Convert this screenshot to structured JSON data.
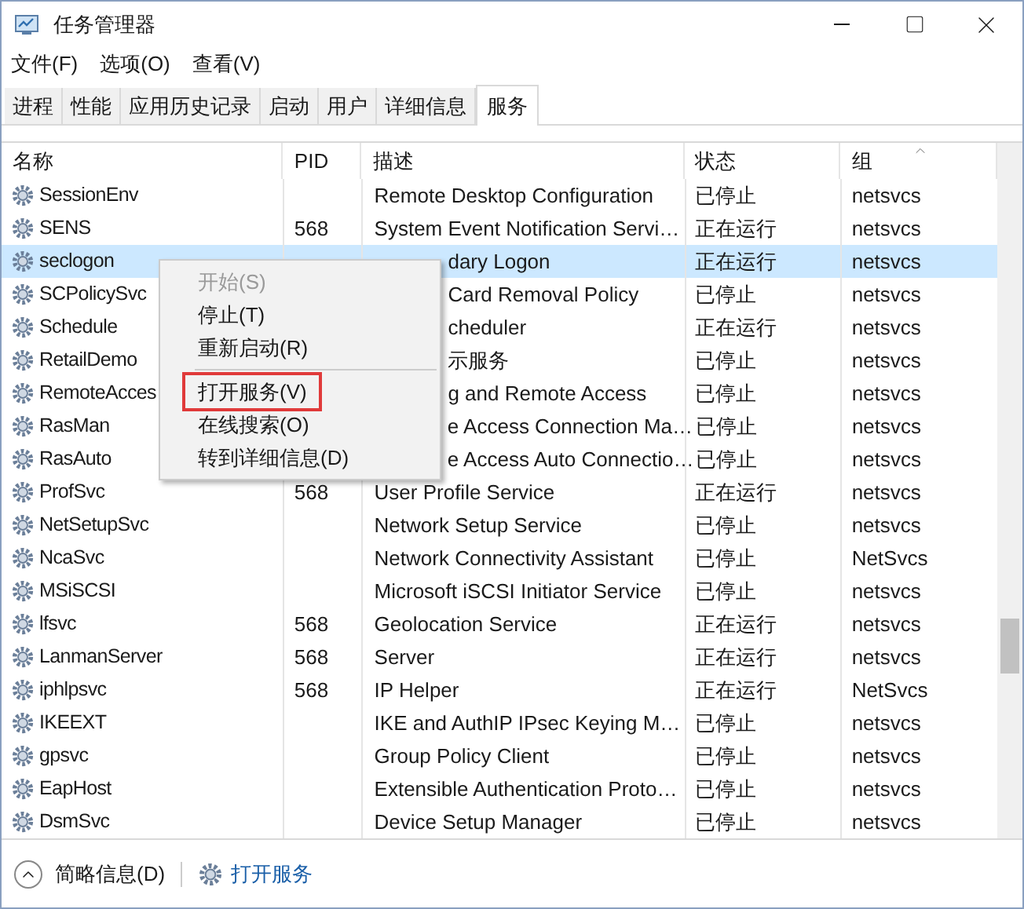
{
  "window": {
    "title": "任务管理器"
  },
  "menu_bar": [
    "文件(F)",
    "选项(O)",
    "查看(V)"
  ],
  "tabs": [
    {
      "label": "进程",
      "selected": false
    },
    {
      "label": "性能",
      "selected": false
    },
    {
      "label": "应用历史记录",
      "selected": false
    },
    {
      "label": "启动",
      "selected": false
    },
    {
      "label": "用户",
      "selected": false
    },
    {
      "label": "详细信息",
      "selected": false
    },
    {
      "label": "服务",
      "selected": true
    }
  ],
  "columns": [
    {
      "label": "名称",
      "sorted": false
    },
    {
      "label": "PID",
      "sorted": false
    },
    {
      "label": "描述",
      "sorted": false
    },
    {
      "label": "状态",
      "sorted": false
    },
    {
      "label": "组",
      "sorted": true
    }
  ],
  "rows": [
    {
      "name": "SessionEnv",
      "description": "Remote Desktop Configuration",
      "status": "已停止",
      "group": "netsvcs",
      "selected": false,
      "covered": false
    },
    {
      "name": "SENS",
      "pid": "568",
      "description": "System Event Notification Servi…",
      "status": "正在运行",
      "group": "netsvcs",
      "selected": false,
      "covered": false
    },
    {
      "name": "seclogon",
      "description": "dary Logon",
      "status": "正在运行",
      "group": "netsvcs",
      "selected": true,
      "covered": true
    },
    {
      "name": "SCPolicySvc",
      "description": "Card Removal Policy",
      "status": "已停止",
      "group": "netsvcs",
      "selected": false,
      "covered": true
    },
    {
      "name": "Schedule",
      "description": "cheduler",
      "status": "正在运行",
      "group": "netsvcs",
      "selected": false,
      "covered": true
    },
    {
      "name": "RetailDemo",
      "description": "示服务",
      "status": "已停止",
      "group": "netsvcs",
      "selected": false,
      "covered": true
    },
    {
      "name": "RemoteAcces",
      "description": "g and Remote Access",
      "status": "已停止",
      "group": "netsvcs",
      "selected": false,
      "covered": true
    },
    {
      "name": "RasMan",
      "description": "e Access Connection Ma…",
      "status": "已停止",
      "group": "netsvcs",
      "selected": false,
      "covered": true
    },
    {
      "name": "RasAuto",
      "description": "e Access Auto Connectio…",
      "status": "已停止",
      "group": "netsvcs",
      "selected": false,
      "covered": true
    },
    {
      "name": "ProfSvc",
      "pid": "568",
      "description": "User Profile Service",
      "status": "正在运行",
      "group": "netsvcs",
      "selected": false,
      "covered": false
    },
    {
      "name": "NetSetupSvc",
      "description": "Network Setup Service",
      "status": "已停止",
      "group": "netsvcs",
      "selected": false,
      "covered": false
    },
    {
      "name": "NcaSvc",
      "description": "Network Connectivity Assistant",
      "status": "已停止",
      "group": "NetSvcs",
      "selected": false,
      "covered": false
    },
    {
      "name": "MSiSCSI",
      "description": "Microsoft iSCSI Initiator Service",
      "status": "已停止",
      "group": "netsvcs",
      "selected": false,
      "covered": false
    },
    {
      "name": "lfsvc",
      "pid": "568",
      "description": "Geolocation Service",
      "status": "正在运行",
      "group": "netsvcs",
      "selected": false,
      "covered": false
    },
    {
      "name": "LanmanServer",
      "pid": "568",
      "description": "Server",
      "status": "正在运行",
      "group": "netsvcs",
      "selected": false,
      "covered": false
    },
    {
      "name": "iphlpsvc",
      "pid": "568",
      "description": "IP Helper",
      "status": "正在运行",
      "group": "NetSvcs",
      "selected": false,
      "covered": false
    },
    {
      "name": "IKEEXT",
      "description": "IKE and AuthIP IPsec Keying M…",
      "status": "已停止",
      "group": "netsvcs",
      "selected": false,
      "covered": false
    },
    {
      "name": "gpsvc",
      "description": "Group Policy Client",
      "status": "已停止",
      "group": "netsvcs",
      "selected": false,
      "covered": false
    },
    {
      "name": "EapHost",
      "description": "Extensible Authentication Proto…",
      "status": "已停止",
      "group": "netsvcs",
      "selected": false,
      "covered": false
    },
    {
      "name": "DsmSvc",
      "description": "Device Setup Manager",
      "status": "已停止",
      "group": "netsvcs",
      "selected": false,
      "covered": false
    }
  ],
  "context_menu": [
    {
      "label": "开始(S)",
      "disabled": true,
      "highlighted": false,
      "separator_after": false
    },
    {
      "label": "停止(T)",
      "disabled": false,
      "highlighted": false,
      "separator_after": false
    },
    {
      "label": "重新启动(R)",
      "disabled": false,
      "highlighted": false,
      "separator_after": true
    },
    {
      "label": "打开服务(V)",
      "disabled": false,
      "highlighted": true,
      "separator_after": false
    },
    {
      "label": "在线搜索(O)",
      "disabled": false,
      "highlighted": false,
      "separator_after": false
    },
    {
      "label": "转到详细信息(D)",
      "disabled": false,
      "highlighted": false,
      "separator_after": false
    }
  ],
  "footer": {
    "details_button": "简略信息(D)",
    "open_services_link": "打开服务"
  }
}
